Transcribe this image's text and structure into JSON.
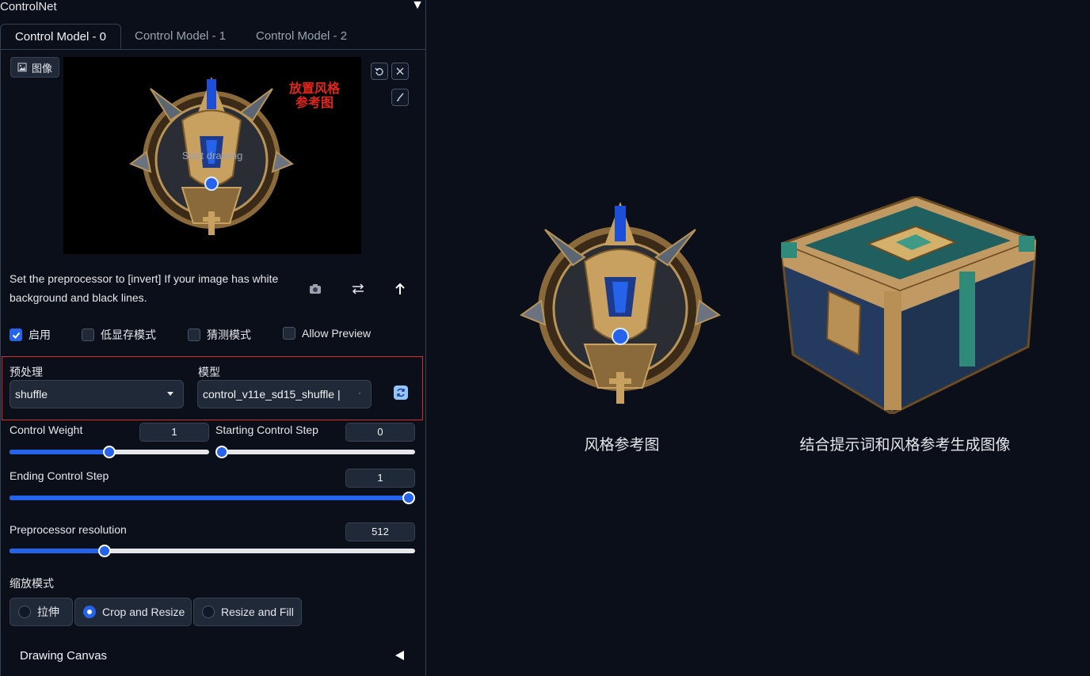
{
  "header": {
    "title": "ControlNet"
  },
  "tabs": [
    {
      "label": "Control Model - 0"
    },
    {
      "label": "Control Model - 1"
    },
    {
      "label": "Control Model - 2"
    }
  ],
  "image": {
    "label": "图像",
    "hint": "Start drawing",
    "overlay_line1": "放置风格",
    "overlay_line2": "参考图"
  },
  "hint_text": "Set the preprocessor to [invert] If your image has white background and black lines.",
  "checkboxes": [
    {
      "label": "启用",
      "checked": true
    },
    {
      "label": "低显存模式",
      "checked": false
    },
    {
      "label": "猜测模式",
      "checked": false
    },
    {
      "label": "Allow Preview",
      "checked": false
    }
  ],
  "preprocessor": {
    "label": "预处理",
    "value": "shuffle"
  },
  "model": {
    "label": "模型",
    "value": "control_v11e_sd15_shuffle |"
  },
  "sliders": {
    "control_weight": {
      "label": "Control Weight",
      "value": "1",
      "fraction": 0.5
    },
    "starting_step": {
      "label": "Starting Control Step",
      "value": "0",
      "fraction": 0.0
    },
    "ending_step": {
      "label": "Ending Control Step",
      "value": "1",
      "fraction": 1.0
    },
    "preproc_res": {
      "label": "Preprocessor resolution",
      "value": "512",
      "fraction": 0.235
    }
  },
  "resize_mode": {
    "label": "缩放模式",
    "options": [
      {
        "label": "拉伸",
        "selected": false
      },
      {
        "label": "Crop and Resize",
        "selected": true
      },
      {
        "label": "Resize and Fill",
        "selected": false
      }
    ]
  },
  "drawing_canvas": {
    "label": "Drawing Canvas"
  },
  "right": {
    "caption_left": "风格参考图",
    "caption_right": "结合提示词和风格参考生成图像"
  }
}
